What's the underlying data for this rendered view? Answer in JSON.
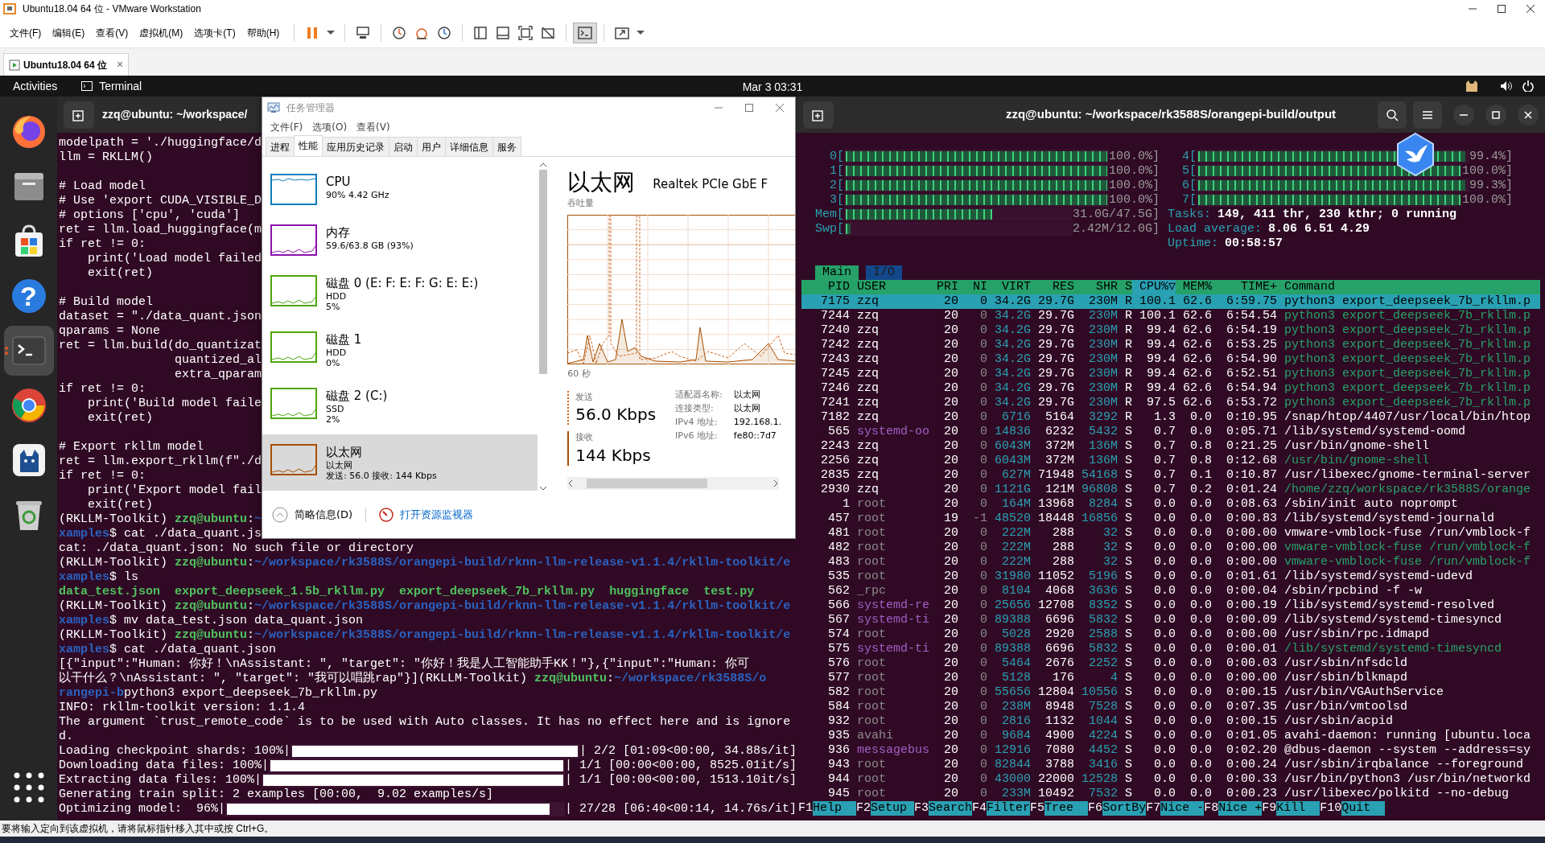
{
  "vmware": {
    "title": "Ubuntu18.04 64 位 - VMware Workstation",
    "menus": [
      "文件(F)",
      "编辑(E)",
      "查看(V)",
      "虚拟机(M)",
      "选项卡(T)",
      "帮助(H)"
    ],
    "tab": {
      "label": "Ubuntu18.04 64 位",
      "close": "×"
    },
    "status": "要将输入定向到该虚拟机，请将鼠标指针移入其中或按 Ctrl+G。"
  },
  "ubuntu_bar": {
    "activities": "Activities",
    "app": "Terminal",
    "clock": "Mar 3  03:31"
  },
  "dock": [
    {
      "kind": "firefox",
      "running": false
    },
    {
      "kind": "files",
      "running": false
    },
    {
      "kind": "software",
      "running": false
    },
    {
      "kind": "help",
      "glyph": "?",
      "running": false
    },
    {
      "kind": "terminal",
      "running": true
    },
    {
      "kind": "chrome",
      "running": false
    },
    {
      "kind": "cat",
      "running": false
    },
    {
      "kind": "trash",
      "running": false
    },
    {
      "kind": "apps",
      "running": false
    }
  ],
  "left_terminal": {
    "title": "zzq@ubuntu: ~/workspace/",
    "lines": [
      {
        "kind": "text",
        "text": "modelpath = './huggingface/d"
      },
      {
        "kind": "text",
        "text": "llm = RKLLM()"
      },
      {
        "kind": "blank"
      },
      {
        "kind": "text",
        "text": "# Load model"
      },
      {
        "kind": "text",
        "text": "# Use 'export CUDA_VISIBLE_D"
      },
      {
        "kind": "text",
        "text": "# options ['cpu', 'cuda']"
      },
      {
        "kind": "text",
        "text": "ret = llm.load_huggingface(m"
      },
      {
        "kind": "text",
        "text": "if ret != 0:"
      },
      {
        "kind": "text",
        "text": "    print('Load model failed"
      },
      {
        "kind": "text",
        "text": "    exit(ret)"
      },
      {
        "kind": "blank"
      },
      {
        "kind": "text",
        "text": "# Build model"
      },
      {
        "kind": "text",
        "text": "dataset = \"./data_quant.json"
      },
      {
        "kind": "text",
        "text": "qparams = None"
      },
      {
        "kind": "text",
        "text": "ret = llm.build(do_quantizat"
      },
      {
        "kind": "text",
        "text": "                quantized_al"
      },
      {
        "kind": "text",
        "text": "                extra_qparam"
      },
      {
        "kind": "text",
        "text": "if ret != 0:"
      },
      {
        "kind": "text",
        "text": "    print('Build model faile"
      },
      {
        "kind": "text",
        "text": "    exit(ret)"
      },
      {
        "kind": "blank"
      },
      {
        "kind": "text",
        "text": "# Export rkllm model"
      },
      {
        "kind": "text",
        "text": "ret = llm.export_rkllm(f\"./d"
      },
      {
        "kind": "text",
        "text": "if ret != 0:"
      },
      {
        "kind": "text",
        "text": "    print('Export model fail"
      },
      {
        "kind": "text",
        "text": "    exit(ret)"
      },
      {
        "kind": "mixed",
        "segments": [
          {
            "kind": "text",
            "text": "(RKLLM-Toolkit) "
          },
          {
            "kind": "user",
            "text": "zzq@ubuntu"
          },
          {
            "kind": "text",
            "text": ":"
          },
          {
            "kind": "path",
            "text": "~"
          }
        ]
      },
      {
        "kind": "mixed",
        "segments": [
          {
            "kind": "path",
            "text": "xamples"
          },
          {
            "kind": "text",
            "text": "$ cat ./data_quant.js"
          }
        ]
      },
      {
        "kind": "text",
        "text": "cat: ./data_quant.json: No such file or directory"
      },
      {
        "kind": "mixed",
        "segments": [
          {
            "kind": "text",
            "text": "(RKLLM-Toolkit) "
          },
          {
            "kind": "user",
            "text": "zzq@ubuntu"
          },
          {
            "kind": "text",
            "text": ":"
          },
          {
            "kind": "path",
            "text": "~/workspace/rk3588S/orangepi-build/rknn-llm-release-v1.1.4/rkllm-toolkit/e"
          }
        ]
      },
      {
        "kind": "mixed",
        "segments": [
          {
            "kind": "path",
            "text": "xamples"
          },
          {
            "kind": "text",
            "text": "$ ls"
          }
        ]
      },
      {
        "kind": "mixed",
        "segments": [
          {
            "kind": "file",
            "text": "data_test.json"
          },
          {
            "kind": "file",
            "text": "export_deepseek_1.5b_rkllm.py"
          },
          {
            "kind": "file",
            "text": "export_deepseek_7b_rkllm.py"
          },
          {
            "kind": "file",
            "text": "huggingface"
          },
          {
            "kind": "file",
            "text": "test.py"
          }
        ]
      },
      {
        "kind": "mixed",
        "segments": [
          {
            "kind": "text",
            "text": "(RKLLM-Toolkit) "
          },
          {
            "kind": "user",
            "text": "zzq@ubuntu"
          },
          {
            "kind": "text",
            "text": ":"
          },
          {
            "kind": "path",
            "text": "~/workspace/rk3588S/orangepi-build/rknn-llm-release-v1.1.4/rkllm-toolkit/e"
          }
        ]
      },
      {
        "kind": "mixed",
        "segments": [
          {
            "kind": "path",
            "text": "xamples"
          },
          {
            "kind": "text",
            "text": "$ mv data_test.json data_quant.json"
          }
        ]
      },
      {
        "kind": "mixed",
        "segments": [
          {
            "kind": "text",
            "text": "(RKLLM-Toolkit) "
          },
          {
            "kind": "user",
            "text": "zzq@ubuntu"
          },
          {
            "kind": "text",
            "text": ":"
          },
          {
            "kind": "path",
            "text": "~/workspace/rk3588S/orangepi-build/rknn-llm-release-v1.1.4/rkllm-toolkit/e"
          }
        ]
      },
      {
        "kind": "mixed",
        "segments": [
          {
            "kind": "path",
            "text": "xamples"
          },
          {
            "kind": "text",
            "text": "$ cat ./data_quant.json"
          }
        ]
      },
      {
        "kind": "text",
        "text": "[{\"input\":\"Human: 你好！\\nAssistant: \", \"target\": \"你好！我是人工智能助手KK！\"},{\"input\":\"Human: 你可"
      },
      {
        "kind": "mixed",
        "segments": [
          {
            "kind": "text",
            "text": "以干什么？\\nAssistant: \", \"target\": \"我可以唱跳rap\"}](RKLLM-Toolkit) "
          },
          {
            "kind": "user",
            "text": "zzq@ubuntu"
          },
          {
            "kind": "text",
            "text": ":"
          },
          {
            "kind": "path",
            "text": "~/workspace/rk3588S/o"
          }
        ]
      },
      {
        "kind": "mixed",
        "segments": [
          {
            "kind": "path",
            "text": "rangepi-b"
          },
          {
            "kind": "text",
            "text": "python3 export_deepseek_7b_rkllm.py"
          }
        ]
      },
      {
        "kind": "text",
        "text": "INFO: rkllm-toolkit version: 1.1.4"
      },
      {
        "kind": "text",
        "text": "The argument `trust_remote_code` is to be used with Auto classes. It has no effect here and is ignore"
      },
      {
        "kind": "text",
        "text": "d."
      },
      {
        "kind": "progress",
        "prefix": "Loading checkpoint shards: 100%|",
        "level": 1,
        "suffix": "| 2/2 [01:09<00:00, 34.88s/it]"
      },
      {
        "kind": "progress",
        "prefix": "Downloading data files: 100%|",
        "level": 1,
        "suffix": "| 1/1 [00:00<00:00, 8525.01it/s]"
      },
      {
        "kind": "progress",
        "prefix": "Extracting data files: 100%|",
        "level": 1,
        "suffix": "| 1/1 [00:00<00:00, 1513.10it/s]"
      },
      {
        "kind": "text",
        "text": "Generating train split: 2 examples [00:00,  9.02 examples/s]"
      },
      {
        "kind": "progress",
        "prefix": "Optimizing model:  96%|",
        "level": 0.96,
        "suffix": "| 27/28 [06:40<00:14, 14.76s/it]"
      }
    ]
  },
  "task_manager": {
    "title": "任务管理器",
    "menus": [
      "文件(F)",
      "选项(O)",
      "查看(V)"
    ],
    "tabs": [
      {
        "label": "进程",
        "selected": false
      },
      {
        "label": "性能",
        "selected": true
      },
      {
        "label": "应用历史记录",
        "selected": false
      },
      {
        "label": "启动",
        "selected": false
      },
      {
        "label": "用户",
        "selected": false
      },
      {
        "label": "详细信息",
        "selected": false
      },
      {
        "label": "服务",
        "selected": false
      }
    ],
    "devices": [
      {
        "name": "CPU",
        "lines": [
          "90%  4.42 GHz"
        ],
        "color": "#117dbb",
        "selected": false
      },
      {
        "name": "内存",
        "lines": [
          "59.6/63.8 GB (93%)"
        ],
        "color": "#8b12ae",
        "selected": false
      },
      {
        "name": "磁盘 0 (E: F: E: F: G: E: E:)",
        "lines": [
          "HDD",
          "5%"
        ],
        "color": "#4da60c",
        "selected": false
      },
      {
        "name": "磁盘 1",
        "lines": [
          "HDD",
          "0%"
        ],
        "color": "#4da60c",
        "selected": false
      },
      {
        "name": "磁盘 2 (C:)",
        "lines": [
          "SSD",
          "2%"
        ],
        "color": "#4da60c",
        "selected": false
      },
      {
        "name": "以太网",
        "lines": [
          "以太网",
          "发送: 56.0 接收: 144 Kbps"
        ],
        "color": "#a74f01",
        "selected": true
      }
    ],
    "detail": {
      "title": "以太网",
      "adapter": "Realtek PCIe GbE F",
      "graph_label": "吞吐量",
      "time_label": "60 秒",
      "send_label": "发送",
      "send_value": "56.0 Kbps",
      "recv_label": "接收",
      "recv_value": "144 Kbps",
      "props": [
        {
          "label": "适配器名称:",
          "value": "以太网"
        },
        {
          "label": "连接类型:",
          "value": "以太网"
        },
        {
          "label": "IPv4 地址:",
          "value": "192.168.1."
        },
        {
          "label": "IPv6 地址:",
          "value": "fe80::7d7"
        }
      ]
    },
    "footer": {
      "fewer": "简略信息(D)",
      "monitor": "打开资源监视器"
    }
  },
  "right_terminal": {
    "title": "zzq@ubuntu: ~/workspace/rk3588S/orangepi-build/output",
    "htop": {
      "meters_left": [
        {
          "label": "0[",
          "level": 1,
          "reading": "100.0%]"
        },
        {
          "label": "1[",
          "level": 1,
          "reading": "100.0%]"
        },
        {
          "label": "2[",
          "level": 1,
          "reading": "100.0%]"
        },
        {
          "label": "3[",
          "level": 1,
          "reading": "100.0%]"
        },
        {
          "label": "Mem[",
          "level": 0.65,
          "reading": "31.0G/47.5G]"
        },
        {
          "label": "Swp[",
          "level": 0.02,
          "reading": "2.42M/12.0G]"
        }
      ],
      "meters_right": [
        {
          "label": "4[",
          "level": 0.99,
          "reading": "99.4%]"
        },
        {
          "label": "5[",
          "level": 1,
          "reading": "100.0%]"
        },
        {
          "label": "6[",
          "level": 0.99,
          "reading": "99.3%]"
        },
        {
          "label": "7[",
          "level": 1,
          "reading": "100.0%]"
        }
      ],
      "info": [
        {
          "label": "Tasks:",
          "value": "149, 411 thr, 230 kthr; 0 running"
        },
        {
          "label": "Load average:",
          "value": "8.06 6.51 4.29"
        },
        {
          "label": "Uptime:",
          "value": "00:58:57"
        }
      ],
      "tabs": [
        {
          "label": "Main",
          "selected": true
        },
        {
          "label": "I/O",
          "selected": false
        }
      ],
      "columns": [
        {
          "label": "PID",
          "sorted": false
        },
        {
          "label": "USER",
          "sorted": false
        },
        {
          "label": "PRI",
          "sorted": false
        },
        {
          "label": "NI",
          "sorted": false
        },
        {
          "label": "VIRT",
          "sorted": false
        },
        {
          "label": "RES",
          "sorted": false
        },
        {
          "label": "SHR",
          "sorted": false
        },
        {
          "label": "S",
          "sorted": false
        },
        {
          "label": "CPU%▽",
          "sorted": true
        },
        {
          "label": "MEM%",
          "sorted": false
        },
        {
          "label": "TIME+",
          "sorted": false
        },
        {
          "label": "Command",
          "sorted": false
        }
      ],
      "rows": [
        {
          "cells": [
            "7175",
            "zzq",
            "20",
            "0",
            "34.2G",
            "29.7G",
            "230M",
            "R",
            "100.1",
            "62.6",
            "6:59.75",
            "python3 export_deepseek_7b_rkllm.p"
          ],
          "thread": false,
          "selected": true
        },
        {
          "cells": [
            "7244",
            "zzq",
            "20",
            "0",
            "34.2G",
            "29.7G",
            "230M",
            "R",
            "100.1",
            "62.6",
            "6:54.54",
            "python3 export_deepseek_7b_rkllm.p"
          ],
          "color": "#ffffff",
          "thread": true,
          "selected": false
        },
        {
          "cells": [
            "7240",
            "zzq",
            "20",
            "0",
            "34.2G",
            "29.7G",
            "230M",
            "R",
            "99.4",
            "62.6",
            "6:54.19",
            "python3 export_deepseek_7b_rkllm.p"
          ],
          "color": "#ffffff",
          "thread": true,
          "selected": false
        },
        {
          "cells": [
            "7242",
            "zzq",
            "20",
            "0",
            "34.2G",
            "29.7G",
            "230M",
            "R",
            "99.4",
            "62.6",
            "6:53.25",
            "python3 export_deepseek_7b_rkllm.p"
          ],
          "color": "#ffffff",
          "thread": true,
          "selected": false
        },
        {
          "cells": [
            "7243",
            "zzq",
            "20",
            "0",
            "34.2G",
            "29.7G",
            "230M",
            "R",
            "99.4",
            "62.6",
            "6:54.90",
            "python3 export_deepseek_7b_rkllm.p"
          ],
          "color": "#ffffff",
          "thread": true,
          "selected": false
        },
        {
          "cells": [
            "7245",
            "zzq",
            "20",
            "0",
            "34.2G",
            "29.7G",
            "230M",
            "R",
            "99.4",
            "62.6",
            "6:52.51",
            "python3 export_deepseek_7b_rkllm.p"
          ],
          "color": "#ffffff",
          "thread": true,
          "selected": false
        },
        {
          "cells": [
            "7246",
            "zzq",
            "20",
            "0",
            "34.2G",
            "29.7G",
            "230M",
            "R",
            "99.4",
            "62.6",
            "6:54.94",
            "python3 export_deepseek_7b_rkllm.p"
          ],
          "color": "#ffffff",
          "thread": true,
          "selected": false
        },
        {
          "cells": [
            "7241",
            "zzq",
            "20",
            "0",
            "34.2G",
            "29.7G",
            "230M",
            "R",
            "97.5",
            "62.6",
            "6:53.72",
            "python3 export_deepseek_7b_rkllm.p"
          ],
          "color": "#ffffff",
          "thread": true,
          "selected": false
        },
        {
          "cells": [
            "7182",
            "zzq",
            "20",
            "0",
            "6716",
            "5164",
            "3292",
            "R",
            "1.3",
            "0.0",
            "0:10.95",
            "/snap/htop/4407/usr/local/bin/htop"
          ],
          "color": "#ffffff",
          "thread": false,
          "selected": false
        },
        {
          "cells": [
            "565",
            "systemd-oo",
            "20",
            "0",
            "14836",
            "6232",
            "5432",
            "S",
            "0.7",
            "0.0",
            "0:05.71",
            "/lib/systemd/systemd-oomd"
          ],
          "color": "#a25ec5",
          "thread": false,
          "selected": false
        },
        {
          "cells": [
            "2243",
            "zzq",
            "20",
            "0",
            "6043M",
            "372M",
            "136M",
            "S",
            "0.7",
            "0.8",
            "0:21.25",
            "/usr/bin/gnome-shell"
          ],
          "color": "#ffffff",
          "thread": false,
          "selected": false
        },
        {
          "cells": [
            "2256",
            "zzq",
            "20",
            "0",
            "6043M",
            "372M",
            "136M",
            "S",
            "0.7",
            "0.8",
            "0:12.68",
            "/usr/bin/gnome-shell"
          ],
          "color": "#ffffff",
          "thread": true,
          "selected": false
        },
        {
          "cells": [
            "2835",
            "zzq",
            "20",
            "0",
            "627M",
            "71948",
            "54168",
            "S",
            "0.7",
            "0.1",
            "0:10.87",
            "/usr/libexec/gnome-terminal-server"
          ],
          "color": "#ffffff",
          "thread": false,
          "selected": false
        },
        {
          "cells": [
            "2930",
            "zzq",
            "20",
            "0",
            "1121G",
            "121M",
            "96808",
            "S",
            "0.7",
            "0.2",
            "0:01.24",
            "/home/zzq/workspace/rk3588S/orange"
          ],
          "color": "#ffffff",
          "thread": true,
          "selected": false
        },
        {
          "cells": [
            "1",
            "root",
            "20",
            "0",
            "164M",
            "13968",
            "8284",
            "S",
            "0.0",
            "0.0",
            "0:08.63",
            "/sbin/init auto noprompt"
          ],
          "color": "#8a8a8a",
          "thread": false,
          "selected": false
        },
        {
          "cells": [
            "457",
            "root",
            "19",
            "-1",
            "48520",
            "18448",
            "16856",
            "S",
            "0.0",
            "0.0",
            "0:00.83",
            "/lib/systemd/systemd-journald"
          ],
          "color": "#8a8a8a",
          "thread": false,
          "selected": false
        },
        {
          "cells": [
            "481",
            "root",
            "20",
            "0",
            "222M",
            "288",
            "32",
            "S",
            "0.0",
            "0.0",
            "0:00.00",
            "vmware-vmblock-fuse /run/vmblock-f"
          ],
          "color": "#8a8a8a",
          "thread": false,
          "selected": false
        },
        {
          "cells": [
            "482",
            "root",
            "20",
            "0",
            "222M",
            "288",
            "32",
            "S",
            "0.0",
            "0.0",
            "0:00.00",
            "vmware-vmblock-fuse /run/vmblock-f"
          ],
          "color": "#8a8a8a",
          "thread": true,
          "selected": false
        },
        {
          "cells": [
            "483",
            "root",
            "20",
            "0",
            "222M",
            "288",
            "32",
            "S",
            "0.0",
            "0.0",
            "0:00.00",
            "vmware-vmblock-fuse /run/vmblock-f"
          ],
          "color": "#8a8a8a",
          "thread": true,
          "selected": false
        },
        {
          "cells": [
            "535",
            "root",
            "20",
            "0",
            "31980",
            "11052",
            "5196",
            "S",
            "0.0",
            "0.0",
            "0:01.61",
            "/lib/systemd/systemd-udevd"
          ],
          "color": "#8a8a8a",
          "thread": false,
          "selected": false
        },
        {
          "cells": [
            "562",
            "_rpc",
            "20",
            "0",
            "8104",
            "4068",
            "3636",
            "S",
            "0.0",
            "0.0",
            "0:00.04",
            "/sbin/rpcbind -f -w"
          ],
          "color": "#8a8a8a",
          "thread": false,
          "selected": false
        },
        {
          "cells": [
            "566",
            "systemd-re",
            "20",
            "0",
            "25656",
            "12708",
            "8352",
            "S",
            "0.0",
            "0.0",
            "0:00.19",
            "/lib/systemd/systemd-resolved"
          ],
          "color": "#a25ec5",
          "thread": false,
          "selected": false
        },
        {
          "cells": [
            "567",
            "systemd-ti",
            "20",
            "0",
            "89388",
            "6696",
            "5832",
            "S",
            "0.0",
            "0.0",
            "0:00.09",
            "/lib/systemd/systemd-timesyncd"
          ],
          "color": "#a25ec5",
          "thread": false,
          "selected": false
        },
        {
          "cells": [
            "574",
            "root",
            "20",
            "0",
            "5028",
            "2920",
            "2588",
            "S",
            "0.0",
            "0.0",
            "0:00.00",
            "/usr/sbin/rpc.idmapd"
          ],
          "color": "#8a8a8a",
          "thread": false,
          "selected": false
        },
        {
          "cells": [
            "575",
            "systemd-ti",
            "20",
            "0",
            "89388",
            "6696",
            "5832",
            "S",
            "0.0",
            "0.0",
            "0:00.01",
            "/lib/systemd/systemd-timesyncd"
          ],
          "color": "#a25ec5",
          "thread": true,
          "selected": false
        },
        {
          "cells": [
            "576",
            "root",
            "20",
            "0",
            "5464",
            "2676",
            "2252",
            "S",
            "0.0",
            "0.0",
            "0:00.03",
            "/usr/sbin/nfsdcld"
          ],
          "color": "#8a8a8a",
          "thread": false,
          "selected": false
        },
        {
          "cells": [
            "577",
            "root",
            "20",
            "0",
            "5128",
            "176",
            "4",
            "S",
            "0.0",
            "0.0",
            "0:00.00",
            "/usr/sbin/blkmapd"
          ],
          "color": "#8a8a8a",
          "thread": false,
          "selected": false
        },
        {
          "cells": [
            "582",
            "root",
            "20",
            "0",
            "55656",
            "12804",
            "10556",
            "S",
            "0.0",
            "0.0",
            "0:00.15",
            "/usr/bin/VGAuthService"
          ],
          "color": "#8a8a8a",
          "thread": false,
          "selected": false
        },
        {
          "cells": [
            "584",
            "root",
            "20",
            "0",
            "238M",
            "8948",
            "7528",
            "S",
            "0.0",
            "0.0",
            "0:07.35",
            "/usr/bin/vmtoolsd"
          ],
          "color": "#8a8a8a",
          "thread": false,
          "selected": false
        },
        {
          "cells": [
            "932",
            "root",
            "20",
            "0",
            "2816",
            "1132",
            "1044",
            "S",
            "0.0",
            "0.0",
            "0:00.15",
            "/usr/sbin/acpid"
          ],
          "color": "#8a8a8a",
          "thread": false,
          "selected": false
        },
        {
          "cells": [
            "935",
            "avahi",
            "20",
            "0",
            "9684",
            "4900",
            "4224",
            "S",
            "0.0",
            "0.0",
            "0:01.05",
            "avahi-daemon: running [ubuntu.loca"
          ],
          "color": "#8a8a8a",
          "thread": false,
          "selected": false
        },
        {
          "cells": [
            "936",
            "messagebus",
            "20",
            "0",
            "12916",
            "7080",
            "4452",
            "S",
            "0.0",
            "0.0",
            "0:02.20",
            "@dbus-daemon --system --address=sy"
          ],
          "color": "#a25ec5",
          "thread": false,
          "selected": false
        },
        {
          "cells": [
            "943",
            "root",
            "20",
            "0",
            "82844",
            "3788",
            "3416",
            "S",
            "0.0",
            "0.0",
            "0:00.24",
            "/usr/sbin/irqbalance --foreground"
          ],
          "color": "#8a8a8a",
          "thread": false,
          "selected": false
        },
        {
          "cells": [
            "944",
            "root",
            "20",
            "0",
            "43000",
            "22000",
            "12528",
            "S",
            "0.0",
            "0.0",
            "0:00.33",
            "/usr/bin/python3 /usr/bin/networkd"
          ],
          "color": "#8a8a8a",
          "thread": false,
          "selected": false
        },
        {
          "cells": [
            "945",
            "root",
            "20",
            "0",
            "233M",
            "10492",
            "7532",
            "S",
            "0.0",
            "0.0",
            "0:00.23",
            "/usr/libexec/polkitd --no-debug"
          ],
          "color": "#8a8a8a",
          "thread": false,
          "selected": false
        }
      ],
      "function_keys": [
        {
          "key": "F1",
          "label": "Help"
        },
        {
          "key": "F2",
          "label": "Setup"
        },
        {
          "key": "F3",
          "label": "Search"
        },
        {
          "key": "F4",
          "label": "Filter"
        },
        {
          "key": "F5",
          "label": "Tree"
        },
        {
          "key": "F6",
          "label": "SortBy"
        },
        {
          "key": "F7",
          "label": "Nice -"
        },
        {
          "key": "F8",
          "label": "Nice +"
        },
        {
          "key": "F9",
          "label": "Kill"
        },
        {
          "key": "F10",
          "label": "Quit"
        }
      ]
    }
  }
}
